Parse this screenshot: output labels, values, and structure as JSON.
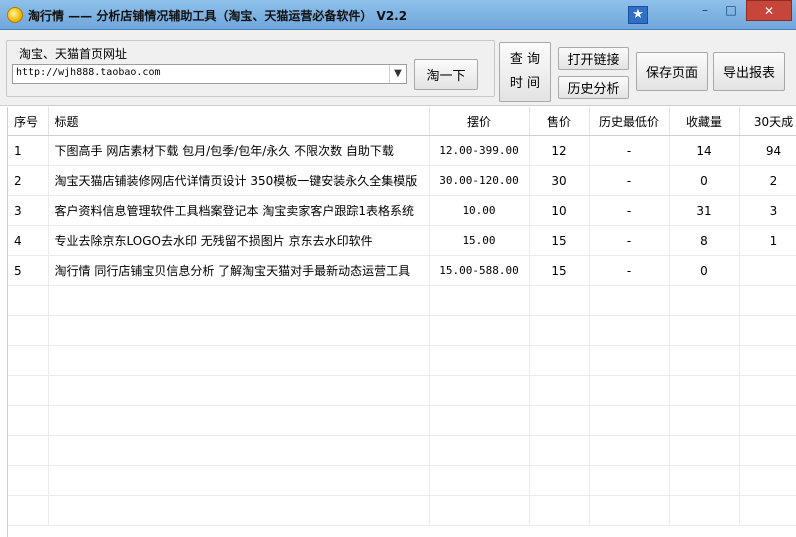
{
  "window": {
    "title": "淘行情 —— 分析店铺情况辅助工具（淘宝、天猫运营必备软件） V2.2",
    "minimize": "–",
    "maximize": "□",
    "close": "✕",
    "star": "★"
  },
  "toolbar": {
    "group_label": "淘宝、天猫首页网址",
    "url_value": "http://wjh888.taobao.com",
    "go_label": "淘一下",
    "query_label_1": "查 询",
    "query_label_2": "时 间",
    "open_link_label": "打开链接",
    "history_label": "历史分析",
    "save_page_label": "保存页面",
    "export_label": "导出报表"
  },
  "table": {
    "columns": [
      "序号",
      "标题",
      "摆价",
      "售价",
      "历史最低价",
      "收藏量",
      "30天成"
    ],
    "rows": [
      {
        "no": "1",
        "title": "下图高手 网店素材下载 包月/包季/包年/永久 不限次数 自助下载",
        "price": "12.00-399.00",
        "sale": "12",
        "low": "-",
        "fav": "14",
        "m30": "94"
      },
      {
        "no": "2",
        "title": "淘宝天猫店铺装修网店代详情页设计 350模板一键安装永久全集模版",
        "price": "30.00-120.00",
        "sale": "30",
        "low": "-",
        "fav": "0",
        "m30": "2"
      },
      {
        "no": "3",
        "title": "客户资料信息管理软件工具档案登记本 淘宝卖家客户跟踪1表格系统",
        "price": "10.00",
        "sale": "10",
        "low": "-",
        "fav": "31",
        "m30": "3"
      },
      {
        "no": "4",
        "title": "专业去除京东LOGO去水印 无残留不损图片 京东去水印软件",
        "price": "15.00",
        "sale": "15",
        "low": "-",
        "fav": "8",
        "m30": "1"
      },
      {
        "no": "5",
        "title": "淘行情 同行店铺宝贝信息分析 了解淘宝天猫对手最新动态运营工具",
        "price": "15.00-588.00",
        "sale": "15",
        "low": "-",
        "fav": "0",
        "m30": ""
      }
    ]
  }
}
